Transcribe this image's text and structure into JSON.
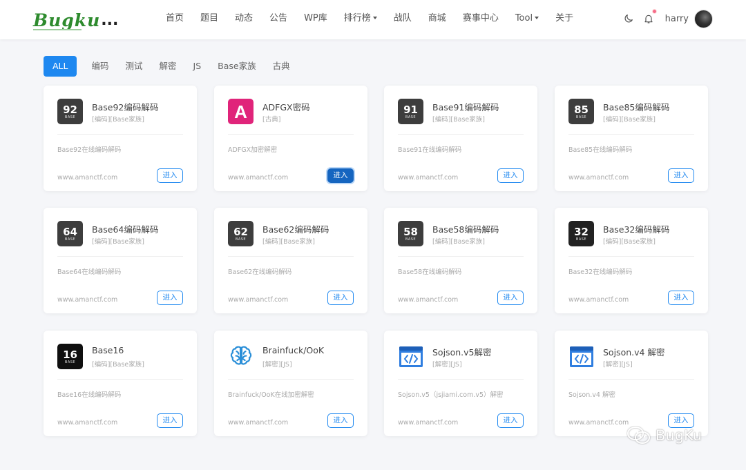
{
  "brand": {
    "logo_text": "Bugku",
    "logo_dots": "...",
    "logo_color": "#2e8b2e"
  },
  "nav": {
    "items": [
      {
        "label": "首页"
      },
      {
        "label": "题目"
      },
      {
        "label": "动态"
      },
      {
        "label": "公告"
      },
      {
        "label": "WP库"
      },
      {
        "label": "排行榜",
        "has_dropdown": true
      },
      {
        "label": "战队"
      },
      {
        "label": "商城"
      },
      {
        "label": "赛事中心"
      },
      {
        "label": "Tool",
        "has_dropdown": true
      },
      {
        "label": "关于"
      }
    ]
  },
  "user": {
    "name": "harry",
    "notification_dot_color": "#f56c8a"
  },
  "filter_tabs": [
    "ALL",
    "编码",
    "测试",
    "解密",
    "JS",
    "Base家族",
    "古典"
  ],
  "active_tab": "ALL",
  "accent_color": "#1e88f0",
  "tools": [
    {
      "icon": "base92-icon",
      "icon_num": "92",
      "icon_sub": "BASE",
      "title": "Base92编码解码",
      "tags": "[编码][Base家族]",
      "desc": "Base92在线编码解码",
      "url": "www.amanctf.com",
      "button": "进入"
    },
    {
      "icon": "adfgx-icon",
      "icon_letter": "A",
      "title": "ADFGX密码",
      "tags": "[古典]",
      "desc": "ADFGX加密解密",
      "url": "www.amanctf.com",
      "button": "进入",
      "button_active": true
    },
    {
      "icon": "base91-icon",
      "icon_num": "91",
      "icon_sub": "BASE",
      "title": "Base91编码解码",
      "tags": "[编码][Base家族]",
      "desc": "Base91在线编码解码",
      "url": "www.amanctf.com",
      "button": "进入"
    },
    {
      "icon": "base85-icon",
      "icon_num": "85",
      "icon_sub": "BASE",
      "title": "Base85编码解码",
      "tags": "[编码][Base家族]",
      "desc": "Base85在线编码解码",
      "url": "www.amanctf.com",
      "button": "进入"
    },
    {
      "icon": "base64-icon",
      "icon_num": "64",
      "icon_sub": "BASE",
      "title": "Base64编码解码",
      "tags": "[编码][Base家族]",
      "desc": "Base64在线编码解码",
      "url": "www.amanctf.com",
      "button": "进入"
    },
    {
      "icon": "base62-icon",
      "icon_num": "62",
      "icon_sub": "BASE",
      "title": "Base62编码解码",
      "tags": "[编码][Base家族]",
      "desc": "Base62在线编码解码",
      "url": "www.amanctf.com",
      "button": "进入"
    },
    {
      "icon": "base58-icon",
      "icon_num": "58",
      "icon_sub": "BASE",
      "title": "Base58编码解码",
      "tags": "[编码][Base家族]",
      "desc": "Base58在线编码解码",
      "url": "www.amanctf.com",
      "button": "进入"
    },
    {
      "icon": "base32-icon",
      "icon_num": "32",
      "icon_sub": "BASE",
      "title": "Base32编码解码",
      "tags": "[编码][Base家族]",
      "desc": "Base32在线编码解码",
      "url": "www.amanctf.com",
      "button": "进入"
    },
    {
      "icon": "base16-icon",
      "icon_num": "16",
      "icon_sub": "BASE",
      "title": "Base16",
      "tags": "[编码][Base家族]",
      "desc": "Base16在线编码解码",
      "url": "www.amanctf.com",
      "button": "进入"
    },
    {
      "icon": "brain-icon",
      "title": "Brainfuck/OoK",
      "tags": "[解密][JS]",
      "desc": "Brainfuck/OoK在线加密解密",
      "url": "www.amanctf.com",
      "button": "进入"
    },
    {
      "icon": "code-window-icon",
      "title": "Sojson.v5解密",
      "tags": "[解密][JS]",
      "desc": "Sojson.v5（jsjiami.com.v5）解密",
      "url": "www.amanctf.com",
      "button": "进入"
    },
    {
      "icon": "code-window-icon",
      "title": "Sojson.v4 解密",
      "tags": "[解密][JS]",
      "desc": "Sojson.v4 解密",
      "url": "www.amanctf.com",
      "button": "进入"
    }
  ],
  "watermark": {
    "text": "BugKu",
    "icon": "wechat-icon"
  }
}
